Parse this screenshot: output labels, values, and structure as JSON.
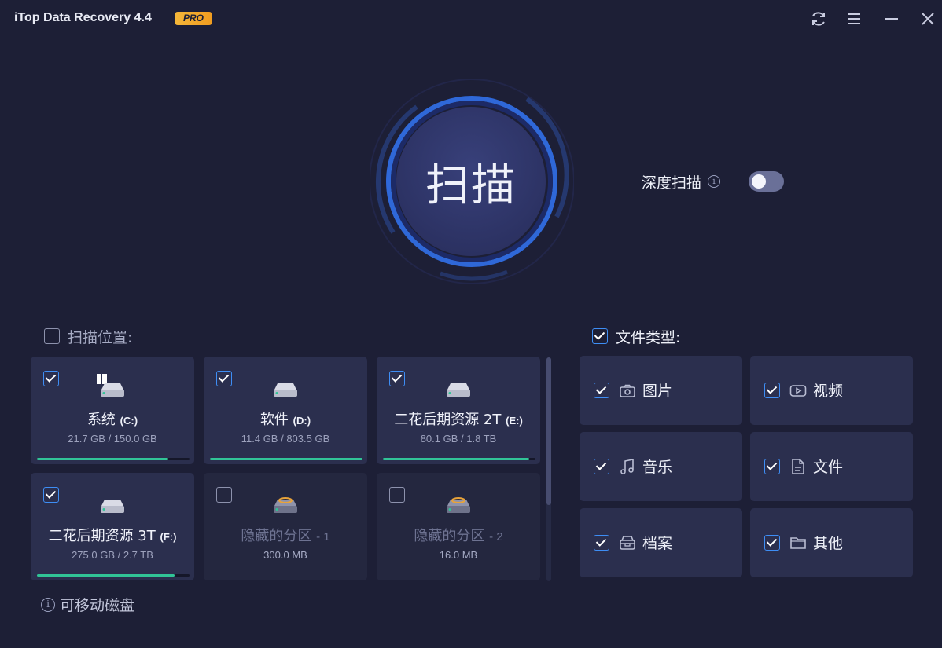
{
  "app": {
    "title": "iTop Data Recovery 4.4",
    "badge": "PRO"
  },
  "scan": {
    "label": "扫描"
  },
  "deep_scan": {
    "label": "深度扫描",
    "enabled": false
  },
  "scan_location": {
    "label": "扫描位置:",
    "checked": false
  },
  "drives": [
    {
      "name": "系统",
      "letter": "(C:)",
      "size": "21.7 GB / 150.0 GB",
      "checked": true,
      "usage": 0.86,
      "system": true
    },
    {
      "name": "软件",
      "letter": "(D:)",
      "size": "11.4 GB / 803.5 GB",
      "checked": true,
      "usage": 1.0
    },
    {
      "name": "二花后期资源 2T",
      "letter": "(E:)",
      "size": "80.1 GB / 1.8 TB",
      "checked": true,
      "usage": 0.96
    },
    {
      "name": "二花后期资源 3T",
      "letter": "(F:)",
      "size": "275.0 GB / 2.7 TB",
      "checked": true,
      "usage": 0.9
    },
    {
      "name": "隐藏的分区",
      "letter": "- 1",
      "size": "300.0 MB",
      "checked": false,
      "hidden": true
    },
    {
      "name": "隐藏的分区",
      "letter": "- 2",
      "size": "16.0 MB",
      "checked": false,
      "hidden": true
    }
  ],
  "removable": {
    "label": "可移动磁盘"
  },
  "file_types": {
    "label": "文件类型:",
    "checked": true,
    "items": [
      {
        "name": "图片",
        "icon": "camera-icon",
        "checked": true
      },
      {
        "name": "视频",
        "icon": "video-icon",
        "checked": true
      },
      {
        "name": "音乐",
        "icon": "music-icon",
        "checked": true
      },
      {
        "name": "文件",
        "icon": "document-icon",
        "checked": true
      },
      {
        "name": "档案",
        "icon": "archive-icon",
        "checked": true
      },
      {
        "name": "其他",
        "icon": "folder-icon",
        "checked": true
      }
    ]
  },
  "colors": {
    "background": "#1d1f36",
    "accent": "#3e8ef5",
    "usage_bar": "#31c497",
    "badge": "#f5b73a"
  }
}
